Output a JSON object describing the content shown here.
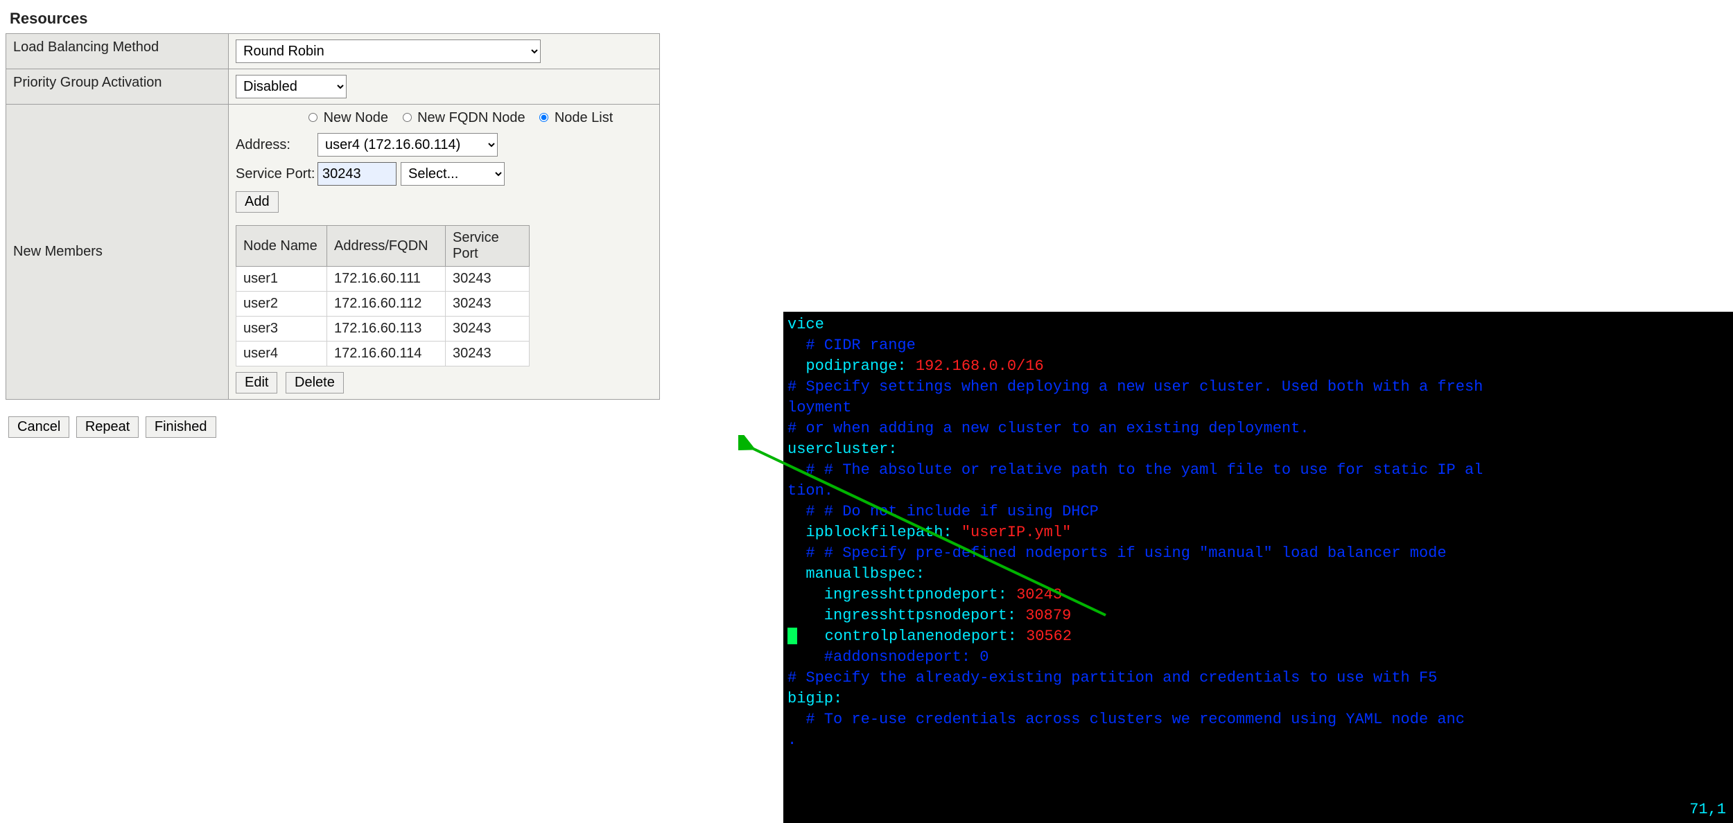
{
  "section_title": "Resources",
  "rows": {
    "lb_method": {
      "label": "Load Balancing Method",
      "value": "Round Robin"
    },
    "pga": {
      "label": "Priority Group Activation",
      "value": "Disabled"
    },
    "new_members": {
      "label": "New Members"
    }
  },
  "node_type": {
    "new_node": "New Node",
    "new_fqdn": "New FQDN Node",
    "node_list": "Node List",
    "selected": "node_list"
  },
  "address": {
    "label": "Address:",
    "value": "user4 (172.16.60.114)"
  },
  "service_port": {
    "label": "Service Port:",
    "value": "30243",
    "select": "Select..."
  },
  "add_btn": "Add",
  "members_table": {
    "headers": [
      "Node Name",
      "Address/FQDN",
      "Service Port"
    ],
    "rows": [
      {
        "name": "user1",
        "addr": "172.16.60.111",
        "port": "30243"
      },
      {
        "name": "user2",
        "addr": "172.16.60.112",
        "port": "30243"
      },
      {
        "name": "user3",
        "addr": "172.16.60.113",
        "port": "30243"
      },
      {
        "name": "user4",
        "addr": "172.16.60.114",
        "port": "30243"
      }
    ]
  },
  "edit_btn": "Edit",
  "delete_btn": "Delete",
  "footer": {
    "cancel": "Cancel",
    "repeat": "Repeat",
    "finished": "Finished"
  },
  "terminal": {
    "lines": [
      {
        "segs": [
          {
            "t": "vice",
            "c": "c-cy"
          }
        ]
      },
      {
        "segs": [
          {
            "t": "  # CIDR range",
            "c": "c-bl"
          }
        ]
      },
      {
        "segs": [
          {
            "t": "  podiprange: ",
            "c": "c-cy"
          },
          {
            "t": "192.168.0.0/16",
            "c": "c-rd"
          }
        ]
      },
      {
        "segs": [
          {
            "t": "# Specify settings when deploying a new user cluster. Used both with a fresh",
            "c": "c-bl"
          }
        ]
      },
      {
        "segs": [
          {
            "t": "loyment",
            "c": "c-bl"
          }
        ]
      },
      {
        "segs": [
          {
            "t": "# or when adding a new cluster to an existing deployment.",
            "c": "c-bl"
          }
        ]
      },
      {
        "segs": [
          {
            "t": "usercluster:",
            "c": "c-cy"
          }
        ]
      },
      {
        "segs": [
          {
            "t": "  # # The absolute or relative path to the yaml file to use for static IP al",
            "c": "c-bl"
          }
        ]
      },
      {
        "segs": [
          {
            "t": "tion.",
            "c": "c-bl"
          }
        ]
      },
      {
        "segs": [
          {
            "t": "  # # Do not include if using DHCP",
            "c": "c-bl"
          }
        ]
      },
      {
        "segs": [
          {
            "t": "  ipblockfilepath: ",
            "c": "c-cy"
          },
          {
            "t": "\"userIP.yml\"",
            "c": "c-rd"
          }
        ]
      },
      {
        "segs": [
          {
            "t": "  # # Specify pre-defined nodeports if using \"manual\" load balancer mode",
            "c": "c-bl"
          }
        ]
      },
      {
        "segs": [
          {
            "t": "  manuallbspec:",
            "c": "c-cy"
          }
        ]
      },
      {
        "segs": [
          {
            "t": "    ingresshttpnodeport: ",
            "c": "c-cy"
          },
          {
            "t": "30243",
            "c": "c-rd"
          }
        ]
      },
      {
        "segs": [
          {
            "t": "    ingresshttpsnodeport: ",
            "c": "c-cy"
          },
          {
            "t": "30879",
            "c": "c-rd"
          }
        ]
      },
      {
        "segs": [
          {
            "t": "",
            "cursor": true
          },
          {
            "t": "   controlplanenodeport: ",
            "c": "c-cy"
          },
          {
            "t": "30562",
            "c": "c-rd"
          }
        ]
      },
      {
        "segs": [
          {
            "t": "    #addonsnodeport: 0",
            "c": "c-bl"
          }
        ]
      },
      {
        "segs": [
          {
            "t": "# Specify the already-existing partition and credentials to use with F5",
            "c": "c-bl"
          }
        ]
      },
      {
        "segs": [
          {
            "t": "bigip:",
            "c": "c-cy"
          }
        ]
      },
      {
        "segs": [
          {
            "t": "  # To re-use credentials across clusters we recommend using YAML node anc",
            "c": "c-bl"
          }
        ]
      },
      {
        "segs": [
          {
            "t": ".",
            "c": "c-bl"
          }
        ]
      }
    ],
    "pos": "71,1"
  }
}
